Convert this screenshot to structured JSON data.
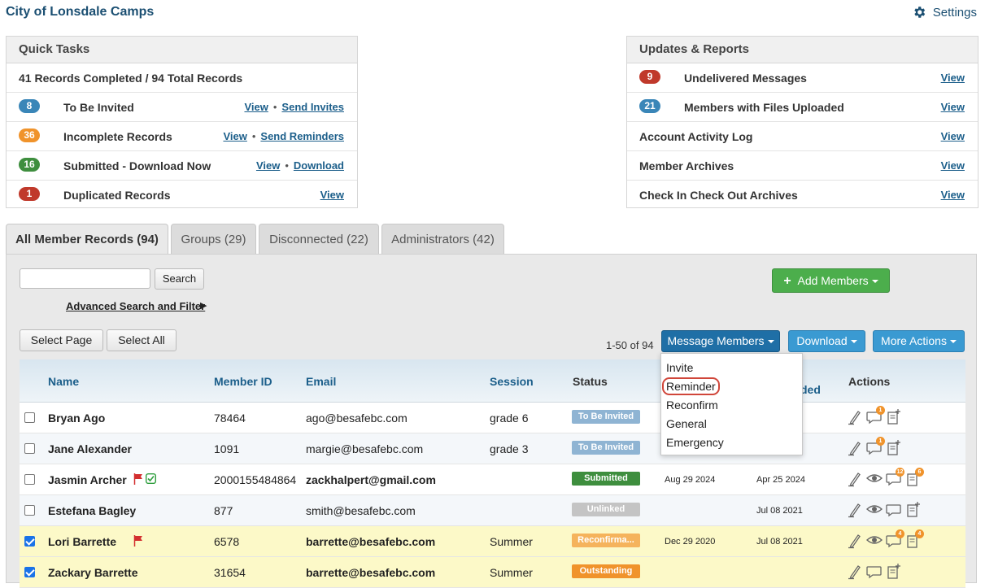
{
  "app": {
    "title": "City of Lonsdale Camps",
    "settings_label": "Settings"
  },
  "quick_tasks": {
    "title": "Quick Tasks",
    "summary": "41 Records Completed / 94 Total Records",
    "items": [
      {
        "count": "8",
        "color": "#3a86b8",
        "label": "To Be Invited",
        "link1": "View",
        "link2": "Send Invites"
      },
      {
        "count": "36",
        "color": "#f0932b",
        "label": "Incomplete Records",
        "link1": "View",
        "link2": "Send Reminders"
      },
      {
        "count": "16",
        "color": "#3e8e3e",
        "label": "Submitted - Download Now",
        "link1": "View",
        "link2": "Download"
      },
      {
        "count": "1",
        "color": "#c0392b",
        "label": "Duplicated Records",
        "link1": "View"
      }
    ]
  },
  "updates": {
    "title": "Updates & Reports",
    "items": [
      {
        "count": "9",
        "color": "#c0392b",
        "label": "Undelivered Messages",
        "link": "View"
      },
      {
        "count": "21",
        "color": "#3a86b8",
        "label": "Members with Files Uploaded",
        "link": "View"
      },
      {
        "label": "Account Activity Log",
        "link": "View"
      },
      {
        "label": "Member Archives",
        "link": "View"
      },
      {
        "label": "Check In Check Out Archives",
        "link": "View"
      }
    ]
  },
  "tabs": [
    {
      "label": "All Member Records (94)",
      "active": true
    },
    {
      "label": "Groups (29)"
    },
    {
      "label": "Disconnected (22)"
    },
    {
      "label": "Administrators (42)"
    }
  ],
  "toolbar": {
    "search_button": "Search",
    "search_value": "",
    "advanced_link": "Advanced Search and Filter",
    "add_members": "Add Members",
    "select_page": "Select Page",
    "select_all": "Select All",
    "count_label": "1-50 of 94",
    "message_members": "Message Members",
    "download": "Download",
    "more_actions": "More Actions"
  },
  "table": {
    "headers": {
      "name": "Name",
      "member_id": "Member ID",
      "email": "Email",
      "session": "Session",
      "status": "Status",
      "uploaded": "ded",
      "actions": "Actions"
    },
    "rows": [
      {
        "name": "Bryan Ago",
        "id": "78464",
        "email": "ago@besafebc.com",
        "session": "grade 6",
        "status": "To Be Invited",
        "status_color": "#8fb4d3",
        "date1": "",
        "date2": "",
        "checked": false,
        "flag": false,
        "check": false,
        "bold_email": false,
        "chat_badge": "1",
        "file_badge": "",
        "eye": false
      },
      {
        "name": "Jane Alexander",
        "id": "1091",
        "email": "margie@besafebc.com",
        "session": "grade 3",
        "status": "To Be Invited",
        "status_color": "#8fb4d3",
        "date1": "",
        "date2": "",
        "checked": false,
        "flag": false,
        "check": false,
        "bold_email": false,
        "chat_badge": "1",
        "file_badge": "",
        "eye": false
      },
      {
        "name": "Jasmin Archer",
        "id": "2000155484864",
        "email": "zackhalpert@gmail.com",
        "session": "",
        "status": "Submitted",
        "status_color": "#3e8e3e",
        "date1": "Aug 29 2024",
        "date2": "Apr 25 2024",
        "checked": false,
        "flag": true,
        "check": true,
        "bold_email": true,
        "chat_badge": "12",
        "file_badge": "6",
        "eye": true
      },
      {
        "name": "Estefana Bagley",
        "id": "877",
        "email": "smith@besafebc.com",
        "session": "",
        "status": "Unlinked",
        "status_color": "#c4c4c4",
        "date1": "",
        "date2": "Jul 08 2021",
        "checked": false,
        "flag": false,
        "check": false,
        "bold_email": false,
        "chat_badge": "",
        "file_badge": "",
        "eye": true
      },
      {
        "name": "Lori Barrette",
        "id": "6578",
        "email": "barrette@besafebc.com",
        "session": "Summer",
        "status": "Reconfirma...",
        "status_color": "#f5b35c",
        "date1": "Dec 29 2020",
        "date2": "Jul 08 2021",
        "checked": true,
        "flag": true,
        "check": false,
        "bold_email": true,
        "chat_badge": "4",
        "file_badge": "4",
        "eye": true
      },
      {
        "name": "Zackary Barrette",
        "id": "31654",
        "email": "barrette@besafebc.com",
        "session": "Summer",
        "status": "Outstanding",
        "status_color": "#f0932b",
        "date1": "",
        "date2": "",
        "checked": true,
        "flag": false,
        "check": false,
        "bold_email": true,
        "chat_badge": "",
        "file_badge": "",
        "eye": false
      }
    ]
  },
  "message_menu": {
    "items": [
      "Invite",
      "Reminder",
      "Reconfirm",
      "General",
      "Emergency"
    ],
    "highlighted": "Reminder"
  }
}
